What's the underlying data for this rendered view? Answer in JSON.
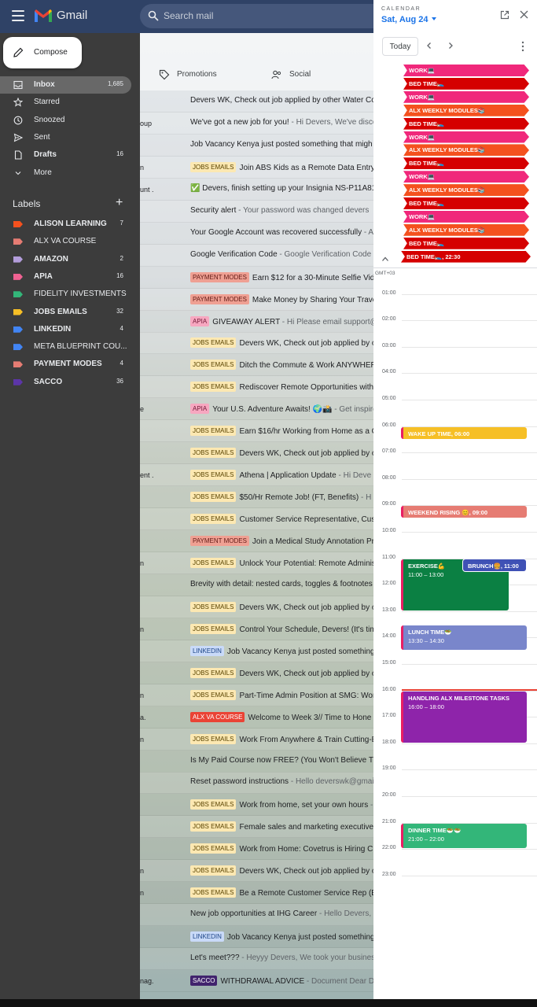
{
  "app": {
    "name": "Gmail"
  },
  "search": {
    "placeholder": "Search mail"
  },
  "compose": {
    "label": "Compose"
  },
  "nav": [
    {
      "label": "Inbox",
      "count": "1,685",
      "icon": "inbox-icon",
      "active": true,
      "bold": true
    },
    {
      "label": "Starred",
      "count": "",
      "icon": "star-icon"
    },
    {
      "label": "Snoozed",
      "count": "",
      "icon": "clock-icon"
    },
    {
      "label": "Sent",
      "count": "",
      "icon": "send-icon"
    },
    {
      "label": "Drafts",
      "count": "16",
      "icon": "draft-icon",
      "bold": true
    },
    {
      "label": "More",
      "count": "",
      "icon": "chevron-down-icon"
    }
  ],
  "labels": {
    "title": "Labels",
    "items": [
      {
        "name": "ALISON LEARNING",
        "count": "7",
        "color": "#f4511e",
        "bold": true
      },
      {
        "name": "ALX VA COURSE",
        "count": "",
        "color": "#e67c73"
      },
      {
        "name": "AMAZON",
        "count": "2",
        "color": "#b39ddb",
        "bold": true
      },
      {
        "name": "APIA",
        "count": "16",
        "color": "#f06292",
        "bold": true
      },
      {
        "name": "FIDELITY INVESTMENTS",
        "count": "",
        "color": "#33b679"
      },
      {
        "name": "JOBS EMAILS",
        "count": "32",
        "color": "#f6bf26",
        "bold": true
      },
      {
        "name": "LINKEDIN",
        "count": "4",
        "color": "#4285f4",
        "bold": true
      },
      {
        "name": "META BLUEPRINT COU...",
        "count": "",
        "color": "#4285f4"
      },
      {
        "name": "PAYMENT MODES",
        "count": "4",
        "color": "#e67c73",
        "bold": true
      },
      {
        "name": "SACCO",
        "count": "36",
        "color": "#5c35a8",
        "bold": true
      }
    ]
  },
  "tabs": [
    {
      "label": "Promotions",
      "icon": "tag-icon"
    },
    {
      "label": "Social",
      "icon": "people-icon"
    }
  ],
  "chips": {
    "JOBS EMAILS": {
      "bg": "#fce8b2",
      "fg": "#594300"
    },
    "PAYMENT MODES": {
      "bg": "#efa093",
      "fg": "#611a15"
    },
    "APIA": {
      "bg": "#f7a7c0",
      "fg": "#711a36"
    },
    "LINKEDIN": {
      "bg": "#c9daf8",
      "fg": "#1c4587"
    },
    "ALX VA COURSE": {
      "bg": "#ea4335",
      "fg": "#ffffff"
    },
    "SACCO": {
      "bg": "#41236d",
      "fg": "#ffffff"
    }
  },
  "emails": [
    {
      "sender": "",
      "chip": "",
      "subject": "Devers WK, Check out job applied by other Water Co",
      "snippet": ""
    },
    {
      "sender": "oup",
      "chip": "",
      "subject": "We've got a new job for you!",
      "snippet": " - Hi Devers, We've disco"
    },
    {
      "sender": "",
      "chip": "",
      "subject": "Job Vacancy Kenya just posted something that migh",
      "snippet": ""
    },
    {
      "sender": "n",
      "chip": "JOBS EMAILS",
      "subject": "Join ABS Kids as a Remote Data Entry",
      "snippet": ""
    },
    {
      "sender": "unt .",
      "chip": "",
      "subject": "✅ Devers, finish setting up your Insignia NS-P11A810",
      "snippet": ""
    },
    {
      "sender": "",
      "chip": "",
      "subject": "Security alert",
      "snippet": " - Your password was changed devers"
    },
    {
      "sender": "",
      "chip": "",
      "subject": "Your Google Account was recovered successfully",
      "snippet": " - A"
    },
    {
      "sender": "",
      "chip": "",
      "subject": "Google Verification Code",
      "snippet": " - Google Verification Code"
    },
    {
      "sender": "",
      "chip": "PAYMENT MODES",
      "subject": "Earn $12 for a 30-Minute Selfie Vid",
      "snippet": ""
    },
    {
      "sender": "",
      "chip": "PAYMENT MODES",
      "subject": "Make Money by Sharing Your Trave",
      "snippet": ""
    },
    {
      "sender": "",
      "chip": "APIA",
      "subject": "GIVEAWAY ALERT",
      "snippet": " - Hi Please email support@a"
    },
    {
      "sender": "",
      "chip": "JOBS EMAILS",
      "subject": "Devers WK, Check out job applied by o",
      "snippet": ""
    },
    {
      "sender": "",
      "chip": "JOBS EMAILS",
      "subject": "Ditch the Commute & Work ANYWHER",
      "snippet": ""
    },
    {
      "sender": "",
      "chip": "JOBS EMAILS",
      "subject": "Rediscover Remote Opportunities with",
      "snippet": ""
    },
    {
      "sender": "e",
      "chip": "APIA",
      "subject": "Your U.S. Adventure Awaits! 🌍📸",
      "snippet": " - Get inspire"
    },
    {
      "sender": "",
      "chip": "JOBS EMAILS",
      "subject": "Earn $16/hr Working from Home as a C",
      "snippet": ""
    },
    {
      "sender": "",
      "chip": "JOBS EMAILS",
      "subject": "Devers WK, Check out job applied by o",
      "snippet": ""
    },
    {
      "sender": "ent .",
      "chip": "JOBS EMAILS",
      "subject": "Athena | Application Update",
      "snippet": " - Hi Deve"
    },
    {
      "sender": "",
      "chip": "JOBS EMAILS",
      "subject": "$50/Hr Remote Job! (FT, Benefits)",
      "snippet": " - H"
    },
    {
      "sender": "",
      "chip": "JOBS EMAILS",
      "subject": "Customer Service Representative, Cus",
      "snippet": ""
    },
    {
      "sender": "",
      "chip": "PAYMENT MODES",
      "subject": "Join a Medical Study Annotation Pr",
      "snippet": ""
    },
    {
      "sender": "n",
      "chip": "JOBS EMAILS",
      "subject": "Unlock Your Potential: Remote Adminis",
      "snippet": ""
    },
    {
      "sender": "",
      "chip": "",
      "subject": "Brevity with detail: nested cards, toggles & footnotes",
      "snippet": ""
    },
    {
      "sender": "",
      "chip": "JOBS EMAILS",
      "subject": "Devers WK, Check out job applied by o",
      "snippet": ""
    },
    {
      "sender": "n",
      "chip": "JOBS EMAILS",
      "subject": "Control Your Schedule, Devers! (It's tim",
      "snippet": ""
    },
    {
      "sender": "",
      "chip": "LINKEDIN",
      "subject": "Job Vacancy Kenya just posted something",
      "snippet": ""
    },
    {
      "sender": "",
      "chip": "JOBS EMAILS",
      "subject": "Devers WK, Check out job applied by o",
      "snippet": ""
    },
    {
      "sender": "n",
      "chip": "JOBS EMAILS",
      "subject": "Part-Time Admin Position at SMG: Wor",
      "snippet": ""
    },
    {
      "sender": "a.",
      "chip": "ALX VA COURSE",
      "subject": "Welcome to Week 3// Time to Hone Y",
      "snippet": ""
    },
    {
      "sender": "n",
      "chip": "JOBS EMAILS",
      "subject": "Work From Anywhere & Train Cutting-E",
      "snippet": ""
    },
    {
      "sender": "",
      "chip": "",
      "subject": "Is My Paid Course now FREE? (You Won't Believe This",
      "snippet": ""
    },
    {
      "sender": "",
      "chip": "",
      "subject": "Reset password instructions",
      "snippet": " - Hello deverswk@gmail"
    },
    {
      "sender": "",
      "chip": "JOBS EMAILS",
      "subject": "Work from home, set your own hours",
      "snippet": " -"
    },
    {
      "sender": "",
      "chip": "JOBS EMAILS",
      "subject": "Female sales and marketing executive",
      "snippet": ""
    },
    {
      "sender": "",
      "chip": "JOBS EMAILS",
      "subject": "Work from Home: Covetrus is Hiring Cu",
      "snippet": ""
    },
    {
      "sender": "n",
      "chip": "JOBS EMAILS",
      "subject": "Devers WK, Check out job applied by o",
      "snippet": ""
    },
    {
      "sender": "n",
      "chip": "JOBS EMAILS",
      "subject": "Be a Remote Customer Service Rep (E",
      "snippet": ""
    },
    {
      "sender": "",
      "chip": "",
      "subject": "New job opportunities at IHG Career",
      "snippet": " - Hello Devers, Y"
    },
    {
      "sender": "",
      "chip": "LINKEDIN",
      "subject": "Job Vacancy Kenya just posted something",
      "snippet": ""
    },
    {
      "sender": "",
      "chip": "",
      "subject": "Let's meet???",
      "snippet": " - Heyyy Devers, We took your busines"
    },
    {
      "sender": "nag.",
      "chip": "SACCO",
      "subject": "WITHDRAWAL ADVICE",
      "snippet": " - Document Dear DE"
    }
  ],
  "calendar": {
    "header_label": "CALENDAR",
    "date": "Sat, Aug 24",
    "today_label": "Today",
    "timezone": "GMT+03",
    "hours": [
      "01:00",
      "02:00",
      "03:00",
      "04:00",
      "05:00",
      "06:00",
      "07:00",
      "08:00",
      "09:00",
      "10:00",
      "11:00",
      "12:00",
      "13:00",
      "14:00",
      "15:00",
      "16:00",
      "17:00",
      "18:00",
      "19:00",
      "20:00",
      "21:00",
      "22:00",
      "23:00"
    ],
    "all_day_events": [
      {
        "label": "WORK💻",
        "color": "#f0287b"
      },
      {
        "label": "BED TIME🛌",
        "color": "#d50000"
      },
      {
        "label": "WORK💻",
        "color": "#f0287b"
      },
      {
        "label": "ALX WEEKLY MODULES📚",
        "color": "#f4511e"
      },
      {
        "label": "BED TIME🛌",
        "color": "#d50000"
      },
      {
        "label": "WORK💻",
        "color": "#f0287b"
      },
      {
        "label": "ALX WEEKLY MODULES📚",
        "color": "#f4511e"
      },
      {
        "label": "BED TIME🛌",
        "color": "#d50000"
      },
      {
        "label": "WORK💻",
        "color": "#f0287b"
      },
      {
        "label": "ALX WEEKLY MODULES📚",
        "color": "#f4511e"
      },
      {
        "label": "BED TIME🛌",
        "color": "#d50000"
      },
      {
        "label": "WORK💻",
        "color": "#f0287b"
      },
      {
        "label": "ALX WEEKLY MODULES📚",
        "color": "#f4511e"
      },
      {
        "label": "BED TIME🛌",
        "color": "#d50000"
      },
      {
        "label": "BED TIME🛌, 22:30",
        "color": "#d50000"
      }
    ],
    "timed_events": [
      {
        "title": "WAKE UP TIME, 06:00",
        "time": "",
        "start": 6.0,
        "end": 6.5,
        "color": "#f6bf26",
        "col": 0,
        "fg": "#ffffff"
      },
      {
        "title": "WEEKEND RISING 😊, 09:00",
        "time": "",
        "start": 9.0,
        "end": 9.5,
        "color": "#e67c73",
        "col": 0,
        "fg": "#ffffff"
      },
      {
        "title": "EXERCISE💪",
        "time": "11:00 – 13:00",
        "start": 11.0,
        "end": 13.0,
        "color": "#0b8043",
        "col": 0,
        "fg": "#ffffff"
      },
      {
        "title": "BRUNCH🍔, 11:00",
        "time": "",
        "start": 11.0,
        "end": 11.5,
        "color": "#3f51b5",
        "col": 1,
        "fg": "#ffffff"
      },
      {
        "title": "LUNCH TIME🥗",
        "time": "13:30 – 14:30",
        "start": 13.5,
        "end": 14.5,
        "color": "#7986cb",
        "col": 0,
        "fg": "#ffffff"
      },
      {
        "title": "HANDLING ALX MILESTONE TASKS",
        "time": "16:00 – 18:00",
        "start": 16.0,
        "end": 18.0,
        "color": "#8e24aa",
        "col": 0,
        "fg": "#ffffff"
      },
      {
        "title": "DINNER TIME🥗🥗",
        "time": "21:00 – 22:00",
        "start": 21.0,
        "end": 22.0,
        "color": "#33b679",
        "col": 0,
        "fg": "#ffffff"
      }
    ],
    "now_hour": 15.95
  }
}
